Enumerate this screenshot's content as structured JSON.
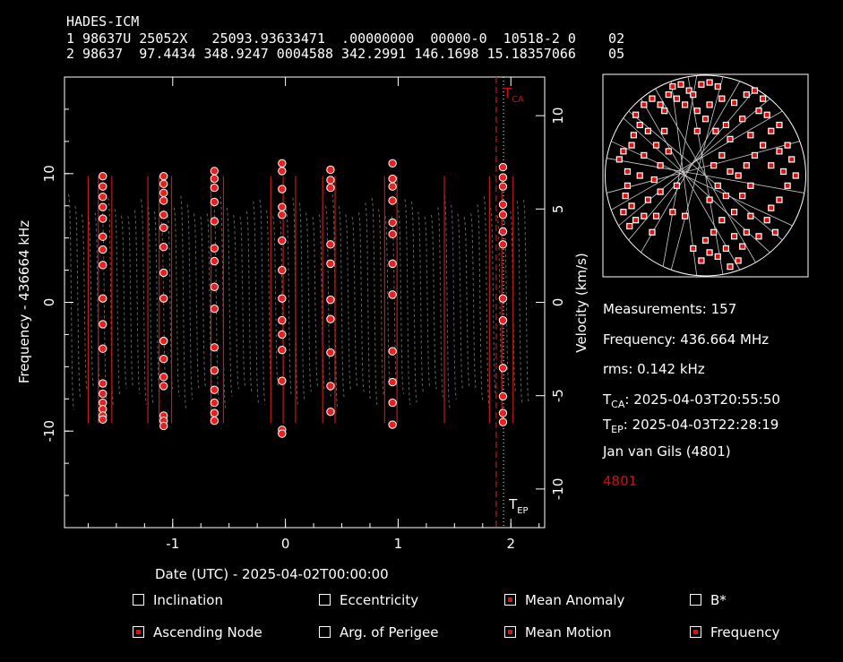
{
  "header": {
    "line0": "HADES-ICM",
    "line1": "1 98637U 25052X   25093.93633471  .00000000  00000-0  10518-2 0    02",
    "line2": "2 98637  97.4434 348.9247 0004588 342.2991 146.1698 15.18357066    05"
  },
  "info": {
    "measurements": "Measurements: 157",
    "frequency": "Frequency: 436.664 MHz",
    "rms": "rms: 0.142 kHz",
    "tca_label": "T",
    "tca_sub": "CA",
    "tca_value": ": 2025-04-03T20:55:50",
    "tep_label": "T",
    "tep_sub": "EP",
    "tep_value": ": 2025-04-03T22:28:19",
    "observer": "Jan van Gils (4801)",
    "site": "4801"
  },
  "options": [
    {
      "label": "Inclination",
      "checked": false
    },
    {
      "label": "Eccentricity",
      "checked": false
    },
    {
      "label": "Mean Anomaly",
      "checked": true
    },
    {
      "label": "B*",
      "checked": false
    },
    {
      "label": "Ascending Node",
      "checked": true
    },
    {
      "label": "Arg. of Perigee",
      "checked": false
    },
    {
      "label": "Mean Motion",
      "checked": true
    },
    {
      "label": "Frequency",
      "checked": true
    }
  ],
  "colors": {
    "accent": "#d01010",
    "marker": "#e82020",
    "model": "#c81818",
    "grid": "#888888"
  },
  "chart_data": {
    "type": "scatter",
    "xlabel": "Date (UTC) - 2025-04-02T00:00:00",
    "ylabel_left": "Frequency - 436664 kHz",
    "ylabel_right": "Velocity (km/s)",
    "xlim": [
      -1.96,
      2.3
    ],
    "ylim": [
      -17.5,
      17.5
    ],
    "x_ticks": [
      "-1",
      "0",
      "1",
      "2"
    ],
    "y_ticks_left": [
      "10",
      "0",
      "-10"
    ],
    "y_ticks_right": [
      "10",
      "5",
      "0",
      "-5",
      "-10"
    ],
    "tca_x": 1.87,
    "tep_x": 1.935,
    "tca_text": "CA",
    "tep_text": "EP",
    "passes": [
      {
        "x": -1.62,
        "values": [
          9.8,
          9.0,
          8.2,
          7.4,
          6.5,
          5.1,
          4.1,
          2.9,
          0.3,
          -1.7,
          -3.6,
          -6.3,
          -7.1,
          -7.8,
          -8.3,
          -8.8,
          -9.1
        ]
      },
      {
        "x": -1.08,
        "values": [
          9.8,
          9.2,
          8.5,
          7.9,
          6.8,
          5.8,
          4.3,
          2.3,
          0.3,
          -3.0,
          -4.4,
          -5.8,
          -6.5,
          -8.8,
          -9.2,
          -9.6
        ]
      },
      {
        "x": -0.63,
        "values": [
          10.2,
          9.6,
          8.9,
          7.8,
          6.3,
          4.2,
          3.2,
          1.2,
          -0.5,
          -3.5,
          -5.3,
          -6.8,
          -7.8,
          -8.6,
          -9.2
        ]
      },
      {
        "x": -0.03,
        "values": [
          10.8,
          10.2,
          8.8,
          7.4,
          6.8,
          4.8,
          2.5,
          0.3,
          -1.4,
          -2.5,
          -3.7,
          -6.1,
          -9.9,
          -10.2
        ]
      },
      {
        "x": 0.4,
        "values": [
          10.3,
          9.5,
          8.9,
          4.5,
          3.0,
          0.2,
          -1.3,
          -3.9,
          -6.5,
          -8.5
        ]
      },
      {
        "x": 0.95,
        "values": [
          10.8,
          9.6,
          9.0,
          7.9,
          6.2,
          5.3,
          3.0,
          0.6,
          -3.8,
          -6.2,
          -7.8,
          -9.5
        ]
      },
      {
        "x": 1.93,
        "values": [
          10.5,
          9.7,
          9.0,
          7.6,
          6.8,
          5.5,
          4.5,
          0.3,
          -1.4,
          -5.1,
          -7.3,
          -8.6,
          -9.3
        ]
      }
    ],
    "model_tracks": [
      -1.75,
      -1.66,
      -1.54,
      -1.22,
      -1.12,
      -1.01,
      -0.66,
      -0.55,
      -0.13,
      -0.02,
      0.09,
      0.33,
      0.44,
      0.88,
      0.99,
      1.41,
      1.81,
      1.92,
      2.02
    ]
  },
  "sky_chart": {
    "points": [
      [
        0.08,
        0.42
      ],
      [
        0.1,
        0.38
      ],
      [
        0.12,
        0.48
      ],
      [
        0.14,
        0.35
      ],
      [
        0.12,
        0.55
      ],
      [
        0.11,
        0.6
      ],
      [
        0.14,
        0.65
      ],
      [
        0.16,
        0.72
      ],
      [
        0.13,
        0.75
      ],
      [
        0.15,
        0.3
      ],
      [
        0.18,
        0.25
      ],
      [
        0.16,
        0.2
      ],
      [
        0.2,
        0.15
      ],
      [
        0.24,
        0.12
      ],
      [
        0.22,
        0.28
      ],
      [
        0.2,
        0.4
      ],
      [
        0.18,
        0.5
      ],
      [
        0.22,
        0.62
      ],
      [
        0.26,
        0.7
      ],
      [
        0.25,
        0.52
      ],
      [
        0.28,
        0.45
      ],
      [
        0.26,
        0.35
      ],
      [
        0.3,
        0.18
      ],
      [
        0.32,
        0.1
      ],
      [
        0.34,
        0.06
      ],
      [
        0.36,
        0.12
      ],
      [
        0.3,
        0.28
      ],
      [
        0.32,
        0.38
      ],
      [
        0.38,
        0.05
      ],
      [
        0.42,
        0.08
      ],
      [
        0.4,
        0.15
      ],
      [
        0.44,
        0.1
      ],
      [
        0.48,
        0.05
      ],
      [
        0.52,
        0.04
      ],
      [
        0.56,
        0.06
      ],
      [
        0.58,
        0.12
      ],
      [
        0.52,
        0.15
      ],
      [
        0.5,
        0.22
      ],
      [
        0.46,
        0.28
      ],
      [
        0.55,
        0.28
      ],
      [
        0.6,
        0.25
      ],
      [
        0.62,
        0.32
      ],
      [
        0.58,
        0.4
      ],
      [
        0.54,
        0.45
      ],
      [
        0.56,
        0.55
      ],
      [
        0.52,
        0.62
      ],
      [
        0.6,
        0.6
      ],
      [
        0.64,
        0.68
      ],
      [
        0.58,
        0.72
      ],
      [
        0.54,
        0.78
      ],
      [
        0.5,
        0.82
      ],
      [
        0.52,
        0.88
      ],
      [
        0.56,
        0.9
      ],
      [
        0.6,
        0.86
      ],
      [
        0.64,
        0.8
      ],
      [
        0.68,
        0.85
      ],
      [
        0.7,
        0.78
      ],
      [
        0.72,
        0.7
      ],
      [
        0.68,
        0.6
      ],
      [
        0.72,
        0.55
      ],
      [
        0.7,
        0.45
      ],
      [
        0.74,
        0.4
      ],
      [
        0.72,
        0.3
      ],
      [
        0.68,
        0.22
      ],
      [
        0.7,
        0.1
      ],
      [
        0.74,
        0.08
      ],
      [
        0.78,
        0.12
      ],
      [
        0.8,
        0.2
      ],
      [
        0.82,
        0.28
      ],
      [
        0.78,
        0.35
      ],
      [
        0.82,
        0.45
      ],
      [
        0.86,
        0.38
      ],
      [
        0.88,
        0.48
      ],
      [
        0.9,
        0.55
      ],
      [
        0.86,
        0.62
      ],
      [
        0.82,
        0.66
      ],
      [
        0.8,
        0.72
      ],
      [
        0.84,
        0.78
      ],
      [
        0.76,
        0.8
      ],
      [
        0.66,
        0.92
      ],
      [
        0.62,
        0.95
      ],
      [
        0.48,
        0.92
      ],
      [
        0.44,
        0.86
      ],
      [
        0.4,
        0.7
      ],
      [
        0.36,
        0.55
      ],
      [
        0.34,
        0.68
      ],
      [
        0.92,
        0.42
      ],
      [
        0.94,
        0.5
      ],
      [
        0.9,
        0.35
      ],
      [
        0.86,
        0.25
      ],
      [
        0.76,
        0.18
      ],
      [
        0.64,
        0.14
      ],
      [
        0.46,
        0.18
      ],
      [
        0.28,
        0.58
      ],
      [
        0.2,
        0.7
      ],
      [
        0.24,
        0.78
      ],
      [
        0.1,
        0.68
      ],
      [
        0.28,
        0.15
      ],
      [
        0.62,
        0.48
      ],
      [
        0.66,
        0.5
      ]
    ]
  }
}
